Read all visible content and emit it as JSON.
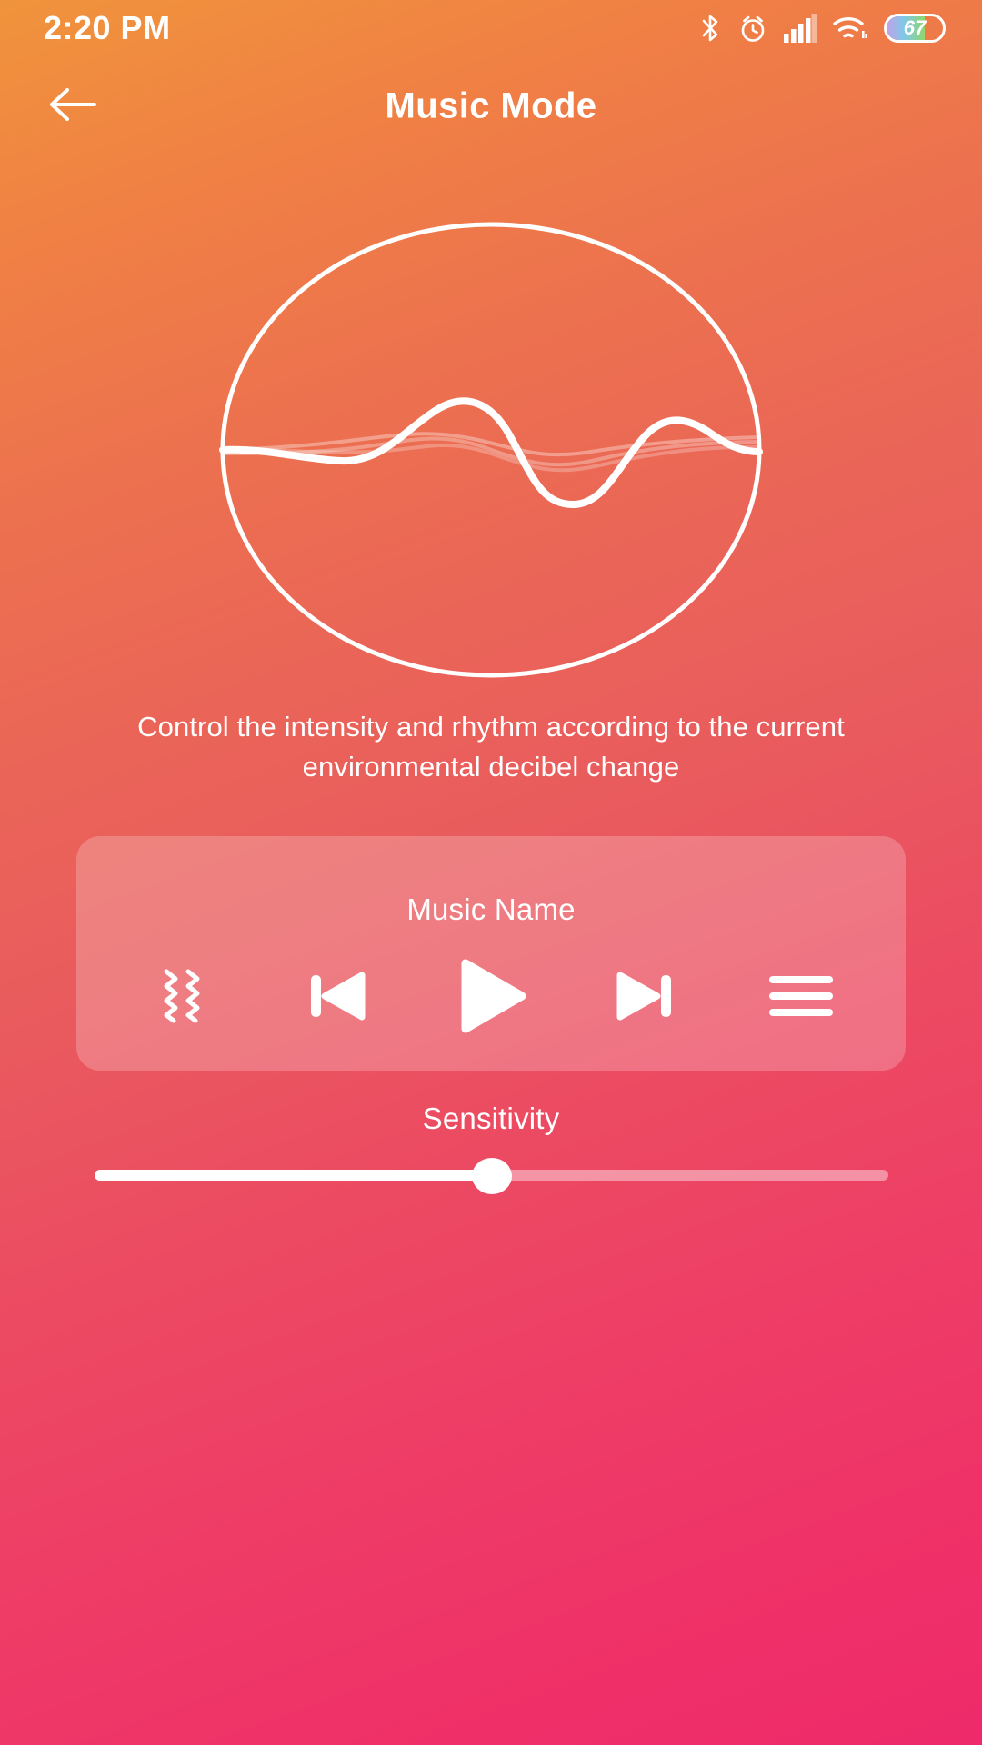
{
  "status_bar": {
    "time": "2:20 PM",
    "battery_percent": "67",
    "icons": [
      "bluetooth-icon",
      "alarm-icon",
      "signal-icon",
      "wifi-icon",
      "battery-icon"
    ]
  },
  "app_bar": {
    "back_label": "back-arrow-icon",
    "title": "Music Mode"
  },
  "hero": {
    "visual": "circle-waveform-graphic"
  },
  "description": {
    "text": "Control the intensity and rhythm according to the current environmental decibel change"
  },
  "player": {
    "music_name": "Music Name",
    "controls": [
      {
        "name": "vibration",
        "icon": "vibration-icon"
      },
      {
        "name": "previous",
        "icon": "previous-track-icon"
      },
      {
        "name": "play",
        "icon": "play-icon"
      },
      {
        "name": "next",
        "icon": "next-track-icon"
      },
      {
        "name": "playlist",
        "icon": "hamburger-menu-icon"
      }
    ]
  },
  "sensitivity": {
    "label": "Sensitivity",
    "value_percent": 50
  },
  "colors": {
    "gradient_top": "#f0943c",
    "gradient_bottom": "#ee2a6a",
    "foreground": "#ffffff",
    "card_overlay": "rgba(255,255,255,0.22)"
  }
}
